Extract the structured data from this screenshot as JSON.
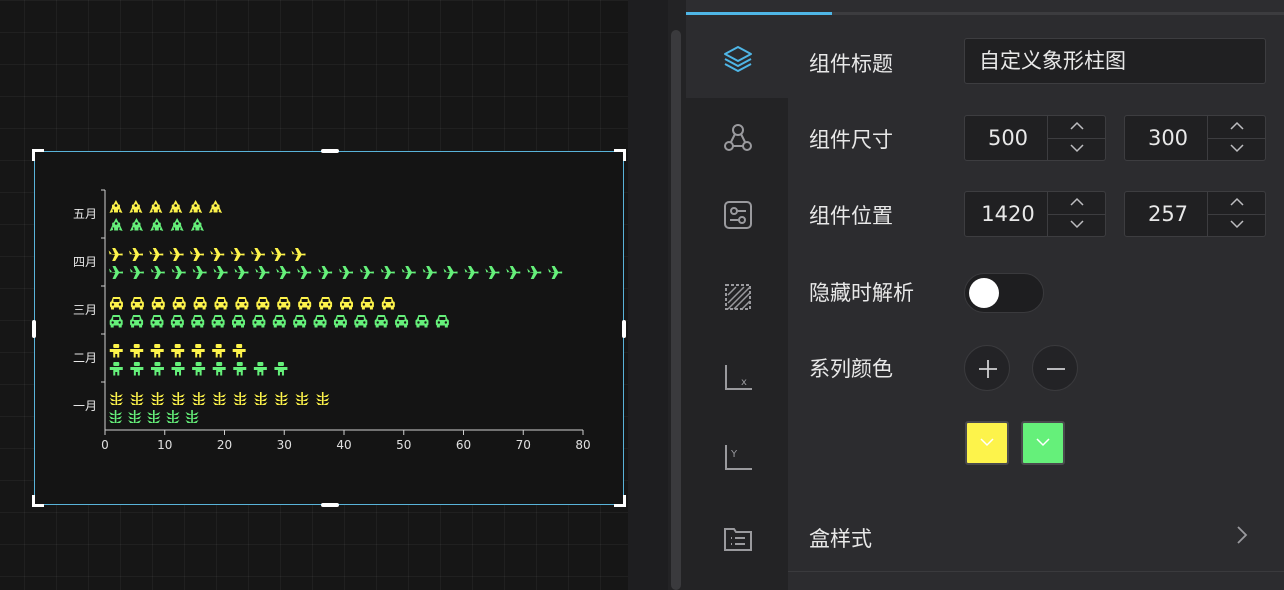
{
  "chart_data": {
    "type": "bar",
    "subtype": "pictorial-horizontal",
    "categories": [
      "一月",
      "二月",
      "三月",
      "四月",
      "五月"
    ],
    "series": [
      {
        "color": "#65f07a",
        "symbol": "leaf",
        "values": [
          16,
          31,
          58,
          77,
          17
        ]
      },
      {
        "color": "#fdf34b",
        "symbol": "robot/car/plane/ship (per category)",
        "values": [
          38,
          24,
          49,
          34,
          20
        ]
      }
    ],
    "category_symbols": [
      "leaf-icon",
      "robot-icon",
      "car-icon",
      "plane-icon",
      "ship-icon"
    ],
    "xlim": [
      0,
      80
    ],
    "x_ticks": [
      "0",
      "10",
      "20",
      "30",
      "40",
      "50",
      "60",
      "70",
      "80"
    ],
    "legend": "none",
    "grid": false
  },
  "panel": {
    "title_label": "组件标题",
    "title_value": "自定义象形柱图",
    "size_label": "组件尺寸",
    "size_width": "500",
    "size_height": "300",
    "position_label": "组件位置",
    "position_x": "1420",
    "position_y": "257",
    "hide_parse_label": "隐藏时解析",
    "hide_parse_on": false,
    "series_color_label": "系列颜色",
    "series_colors": [
      "#fdf34b",
      "#65f07a"
    ],
    "box_style_label": "盒样式"
  },
  "rail": {
    "icons": [
      "layers-icon",
      "nodes-icon",
      "settings-sliders-icon",
      "crop-area-icon",
      "x-axis-icon",
      "y-axis-icon",
      "file-list-icon"
    ],
    "x_axis_letter": "x",
    "y_axis_letter": "Y"
  },
  "colors": {
    "accent": "#4fb6e6",
    "selection": "#59b3d9"
  }
}
